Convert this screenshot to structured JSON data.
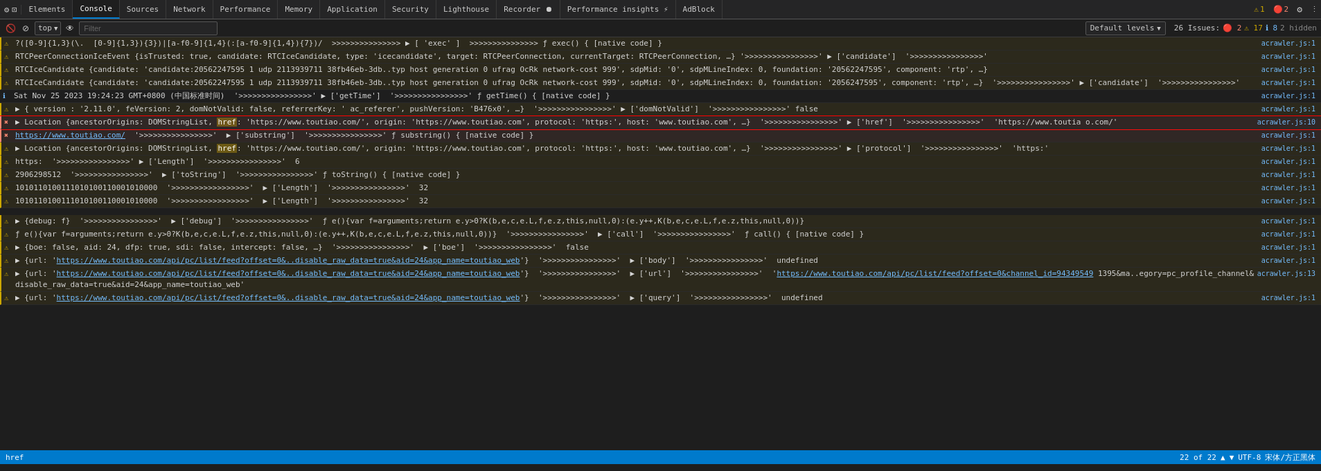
{
  "tabs": [
    {
      "label": "Elements",
      "active": false
    },
    {
      "label": "Console",
      "active": true
    },
    {
      "label": "Sources",
      "active": false
    },
    {
      "label": "Network",
      "active": false
    },
    {
      "label": "Performance",
      "active": false
    },
    {
      "label": "Memory",
      "active": false
    },
    {
      "label": "Application",
      "active": false
    },
    {
      "label": "Security",
      "active": false
    },
    {
      "label": "Lighthouse",
      "active": false
    },
    {
      "label": "Recorder ⏺",
      "active": false
    },
    {
      "label": "Performance insights ⚡",
      "active": false
    },
    {
      "label": "AdBlock",
      "active": false
    }
  ],
  "console_toolbar": {
    "filter_placeholder": "Filter",
    "top_label": "top",
    "default_levels": "Default levels",
    "issues_label": "26 Issues:",
    "issues_red": "2",
    "issues_yellow": "17",
    "issues_blue": "8",
    "hidden_label": "2 hidden"
  },
  "log_rows": [
    {
      "icon": "warning",
      "content": "?([0-9]{1,3}(\\.  [0-9]{1,3}){3})|[a-f0-9]{1,4}(:[a-f0-9]{1,4}){7})/  >>>>>>>>>>>>>>> ▶ [ 'exec' ]  >>>>>>>>>>>>>>> ƒ exec() { [native code] }",
      "source": "acrawler.js:1",
      "type": "warning"
    },
    {
      "icon": "warning",
      "content": "RTCPeerConnectionIceEvent {isTrusted: true, candidate: RTCIceCandidate, type: 'icecandidate', target: RTCPeerConnection, currentTarget: RTCPeerConnection, …} '>>>>>>>>>>>>>>>>' ▶ ['candidate']  '>>>>>>>>>>>>>>>>'",
      "source": "acrawler.js:1",
      "type": "warning"
    },
    {
      "icon": "warning",
      "content": "RTCIceCandidate {candidate: 'candidate:20562247595 1 udp 2113939711 38fb46eb-3db..typ host generation 0 ufrag OcRk network-cost 999', sdpMid: '0', sdpMLineIndex: 0, foundation: '20562247595', component: 'rtp', …}",
      "source": "acrawler.js:1",
      "type": "warning"
    },
    {
      "icon": "warning",
      "content": "RTCIceCandidate {candidate: 'candidate:20562247595 1 udp 2113939711 38fb46eb-3db..typ host generation 0 ufrag OcRk network-cost 999', sdpMid: '0', sdpMLineIndex: 0, foundation: '2056247595', component: 'rtp', …}  '>>>>>>>>>>>>>>>>' ▶ ['candidate']  '>>>>>>>>>>>>>>>>'",
      "source": "acrawler.js:1",
      "type": "warning"
    },
    {
      "icon": "info",
      "content": "Sat Nov 25 2023 19:24:23 GMT+0800 (中国标准时间)  '>>>>>>>>>>>>>>>>' ▶ ['getTime']  '>>>>>>>>>>>>>>>>' ƒ getTime() { [native code] }",
      "source": "acrawler.js:1",
      "type": "info"
    },
    {
      "icon": "warning",
      "content": "▶ { version : '2.11.0', feVersion: 2, domNotValid: false, referrerKey: ' ac_referer', pushVersion: 'B476x0', …}  '>>>>>>>>>>>>>>>>' ▶ ['domNotValid']  '>>>>>>>>>>>>>>>>' false",
      "source": "acrawler.js:1",
      "type": "warning"
    },
    {
      "icon": "error",
      "content": "▶ Location {ancestorOrigins: DOMStringList, href: 'https://www.toutiao.com/', origin: 'https://www.toutiao.com', protocol: 'https:', host: 'www.toutiao.com', …}  '>>>>>>>>>>>>>>>>' ▶ ['href']  '>>>>>>>>>>>>>>>>'  'https://www.toutia o.com/'",
      "source": "acrawler.js:10",
      "type": "error",
      "highlighted": true,
      "has_yellow_highlight": true,
      "yellow_text": "href"
    },
    {
      "icon": "error",
      "content": "https://www.toutiao.com/  '>>>>>>>>>>>>>>>>'  ▶ ['substring']  '>>>>>>>>>>>>>>>>' ƒ substring() { [native code] }",
      "source": "acrawler.js:1",
      "type": "error"
    },
    {
      "icon": "warning",
      "content": "▶ Location {ancestorOrigins: DOMStringList, href: 'https://www.toutiao.com/', origin: 'https://www.toutiao.com', protocol: 'https:', host: 'www.toutiao.com', …}  '>>>>>>>>>>>>>>>>' ▶ ['protocol']  '>>>>>>>>>>>>>>>>'  'https:'",
      "source": "acrawler.js:1",
      "type": "warning",
      "has_yellow_highlight": true,
      "yellow_text": "href"
    },
    {
      "icon": "warning",
      "content": "https:  '>>>>>>>>>>>>>>>>' ▶ ['Length']  '>>>>>>>>>>>>>>>>'  6",
      "source": "acrawler.js:1",
      "type": "warning"
    },
    {
      "icon": "warning",
      "content": "2906298512  '>>>>>>>>>>>>>>>>'  ▶ ['toString']  '>>>>>>>>>>>>>>>>' ƒ toString() { [native code] }",
      "source": "acrawler.js:1",
      "type": "warning"
    },
    {
      "icon": "warning",
      "content": "1010110100111010100110001010000  '>>>>>>>>>>>>>>>>>'  ▶ ['Length']  '>>>>>>>>>>>>>>>>'  32",
      "source": "acrawler.js:1",
      "type": "warning"
    },
    {
      "icon": "warning",
      "content": "1010110100111010100110001010000  '>>>>>>>>>>>>>>>>>'  ▶ ['Length']  '>>>>>>>>>>>>>>>>'  32",
      "source": "acrawler.js:1",
      "type": "warning"
    },
    {
      "icon": "warning",
      "content": "",
      "source": "",
      "type": "spacer"
    },
    {
      "icon": "warning",
      "content": "▶ {debug: f}  '>>>>>>>>>>>>>>>>'  ▶ ['debug']  '>>>>>>>>>>>>>>>>'  ƒ e(){var f=arguments;return e.y>0?K(b,e,c,e.L,f,e.z,this,null,0):(e.y++,K(b,e,c,e.L,f,e.z,this,null,0))}",
      "source": "acrawler.js:1",
      "type": "warning"
    },
    {
      "icon": "warning",
      "content": "ƒ e(){var f=arguments;return e.y>0?K(b,e,c,e.L,f,e.z,this,null,0):(e.y++,K(b,e,c,e.L,f,e.z,this,null,0))}  '>>>>>>>>>>>>>>>>'  ▶ ['call']  '>>>>>>>>>>>>>>>>'  ƒ call() { [native code] }",
      "source": "acrawler.js:1",
      "type": "warning"
    },
    {
      "icon": "warning",
      "content": "▶ {boe: false, aid: 24, dfp: true, sdi: false, intercept: false, …}  '>>>>>>>>>>>>>>>>'  ▶ ['boe']  '>>>>>>>>>>>>>>>>'  false",
      "source": "acrawler.js:1",
      "type": "warning"
    },
    {
      "icon": "warning",
      "content": "▶ {url: 'https://www.toutiao.com/api/pc/list/feed?offset=0&..disable_raw_data=true&aid=24&app_name=toutiao_web'}  '>>>>>>>>>>>>>>>>'  ▶ ['body']  '>>>>>>>>>>>>>>>>'  undefined",
      "source": "acrawler.js:1",
      "type": "warning"
    },
    {
      "icon": "warning",
      "content": "▶ {url: 'https://www.toutiao.com/api/pc/list/feed?offset=0&..disable_raw_data=true&aid=24&app_name=toutiao_web'}  '>>>>>>>>>>>>>>>>'  ▶ ['url']  '>>>>>>>>>>>>>>>>'  'https://www.toutiao.com/api/pc/list/feed?offset=0&channel_id=94349549 1395&ma..egory=pc_profile_channel&disable_raw_data=true&aid=24&app_name=toutiao_web'",
      "source": "acrawler.js:13",
      "type": "warning"
    },
    {
      "icon": "warning",
      "content": "▶ {url: 'https://www.toutiao.com/api/pc/list/feed?offset=0&..disable_raw_data=true&aid=24&app_name=toutiao_web'}  '>>>>>>>>>>>>>>>>'  ▶ ['query']  '>>>>>>>>>>>>>>>>'  undefined",
      "source": "acrawler.js:1",
      "type": "warning"
    }
  ],
  "status_bar": {
    "breadcrumb": "href",
    "position": "22 of 22",
    "encoding": "UTF-8",
    "font_info": "宋体/方正黑体"
  }
}
